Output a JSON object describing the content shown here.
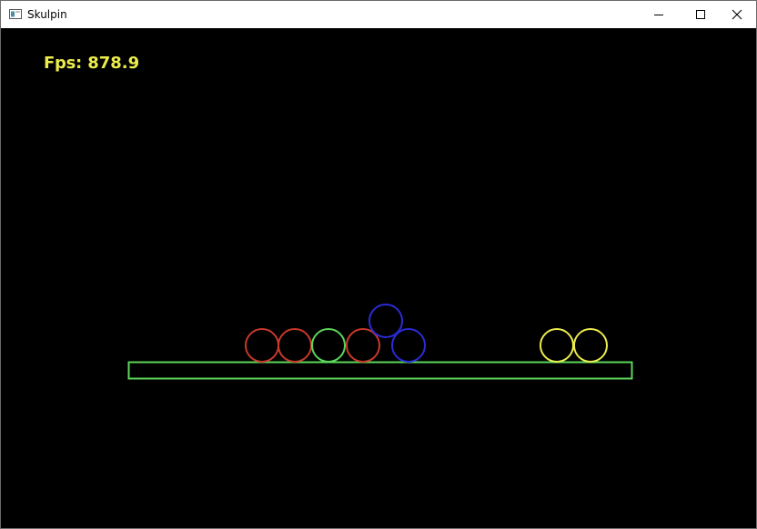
{
  "window": {
    "title": "Skulpin"
  },
  "hud": {
    "fps_label": "Fps:",
    "fps_value": "878.9",
    "text_color": "#ecec4d"
  },
  "scene": {
    "background_color": "#000000",
    "ground_color": "#5cd65c",
    "balls": [
      {
        "color": "#c8392b"
      },
      {
        "color": "#c8392b"
      },
      {
        "color": "#5cd65c"
      },
      {
        "color": "#c8392b"
      },
      {
        "color": "#2b2bd6"
      },
      {
        "color": "#2b2bd6"
      },
      {
        "color": "#ecec4d"
      },
      {
        "color": "#ecec4d"
      }
    ]
  }
}
